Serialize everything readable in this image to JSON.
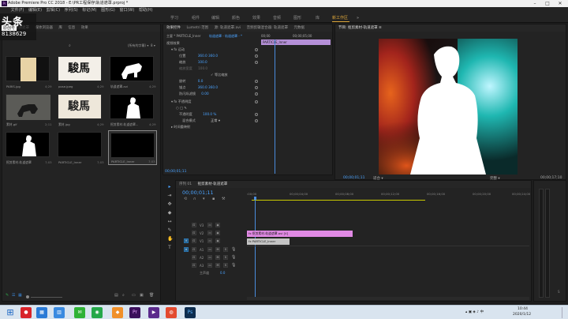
{
  "window": {
    "title": "Adobe Premiere Pro CC 2018 - E:\\PR工程保存\\轨道遮罩.prproj *",
    "icon_text": "Pr"
  },
  "menu": [
    "文件(F)",
    "编辑(E)",
    "剪辑(C)",
    "序列(S)",
    "标记(M)",
    "图形(G)",
    "窗口(W)",
    "帮助(H)"
  ],
  "workspaces": [
    "学习",
    "组件",
    "编辑",
    "颜色",
    "效果",
    "音频",
    "图形",
    "库",
    "新工作区"
  ],
  "watermark": {
    "big": "头条",
    "sub": "原创号",
    "num": "8138629"
  },
  "project_panel": {
    "tabs": [
      "项目: 轨道遮罩",
      "媒体浏览器",
      "库",
      "信息",
      "效果"
    ],
    "filter_label": "(所有的字幕) ▾",
    "item_count": "8 ▾",
    "items": [
      {
        "name": "PARIS.jpg",
        "dur": "4;29"
      },
      {
        "name": "pose.jpeg",
        "dur": "4;29"
      },
      {
        "name": "轨道遮罩.avi",
        "dur": "4;29"
      },
      {
        "name": "素材.gif",
        "dur": "2;11"
      },
      {
        "name": "素材.jpg",
        "dur": "4;29"
      },
      {
        "name": "抠剪素材-轨道遮罩...",
        "dur": "4;29"
      },
      {
        "name": "抠剪素材-轨道遮罩",
        "dur": "7;03"
      },
      {
        "name": "PARTICLE_Inner",
        "dur": "7;03"
      },
      {
        "name": "PARTICLE_Inner",
        "dur": "7;03"
      }
    ]
  },
  "effect_controls": {
    "tabs": [
      "效果控件",
      "Lumetri 范围",
      "源: 轨道遮罩.avi",
      "音频剪辑混合器: 轨道遮罩",
      "元数据"
    ],
    "source": "主要 * PARTICLE_Inner",
    "sequence": "轨道遮罩 - 轨道遮罩 - *",
    "time_a": "00;00",
    "time_b": "00;00;05;00",
    "clip_bar_label": "PARTICLE_Inner",
    "rows": [
      {
        "label": "视频效果",
        "value": ""
      },
      {
        "label": "▾ fx 运动",
        "value": ""
      },
      {
        "label": "位置",
        "value": "360.0   360.0"
      },
      {
        "label": "缩放",
        "value": "100.0"
      },
      {
        "label": "缩放宽度",
        "value": "100.0"
      },
      {
        "label": "",
        "value": "✓ 等比缩放"
      },
      {
        "label": "旋转",
        "value": "0.0"
      },
      {
        "label": "锚点",
        "value": "360.0   360.0"
      },
      {
        "label": "防闪烁滤镜",
        "value": "0.00"
      },
      {
        "label": "▾ fx 不透明度",
        "value": ""
      },
      {
        "label": "○ □ ✎",
        "value": ""
      },
      {
        "label": "不透明度",
        "value": "100.0 %"
      },
      {
        "label": "混合模式",
        "value": "正常 ▾"
      },
      {
        "label": "▸ 时间重映射",
        "value": ""
      }
    ],
    "timecode": "00;00;01;11"
  },
  "program_monitor": {
    "tab": "节目: 抠剪素材-轨道遮罩 ≡",
    "timecode_left": "00;00;01;11",
    "fit": "适合 ▾",
    "quality": "完整 ▾",
    "timecode_right": "00;00;17;10"
  },
  "timeline": {
    "tabs": [
      "序列 01",
      "抠剪素材-轨道遮罩"
    ],
    "timecode": "00;00;01;11",
    "ruler": [
      ":00;00",
      "00;00;04;00",
      "00;00;08;00",
      "00;00;12;00",
      "00;00;16;00",
      "00;00;20;00",
      "00;00;24;00"
    ],
    "video_tracks": [
      "V3",
      "V2",
      "V1"
    ],
    "audio_tracks": [
      "A1",
      "A2",
      "A3"
    ],
    "master_label": "主声道",
    "master_val": "0.0",
    "clips": [
      {
        "name": "fx 抠剪素材-轨道遮罩.avi [V]",
        "color": "#e089e4"
      },
      {
        "name": "fx PARTICLE_Inner",
        "color": "#c4c4c4"
      }
    ]
  },
  "taskbar": {
    "time": "10:44",
    "date": "2020/1/12",
    "apps": [
      {
        "name": "start-button",
        "glyph": "⊞",
        "color": "#1a66c4"
      },
      {
        "name": "netease-app",
        "glyph": "●",
        "color": "#d8232a"
      },
      {
        "name": "explorer-app",
        "glyph": "▦",
        "color": "#2a7ad6"
      },
      {
        "name": "grid-app",
        "glyph": "▥",
        "color": "#3a8ae0"
      },
      {
        "name": "wechat-app",
        "glyph": "✉",
        "color": "#2fb236"
      },
      {
        "name": "green-app",
        "glyph": "◉",
        "color": "#25a84a"
      },
      {
        "name": "orange-app",
        "glyph": "◆",
        "color": "#f0902a"
      },
      {
        "name": "premiere-app",
        "glyph": "Pr",
        "color": "#3b0f5c"
      },
      {
        "name": "media-app",
        "glyph": "▶",
        "color": "#5b2a8c"
      },
      {
        "name": "chrome-app",
        "glyph": "◍",
        "color": "#e34a2f"
      },
      {
        "name": "photoshop-app",
        "glyph": "Ps",
        "color": "#0e2d4f"
      }
    ]
  }
}
